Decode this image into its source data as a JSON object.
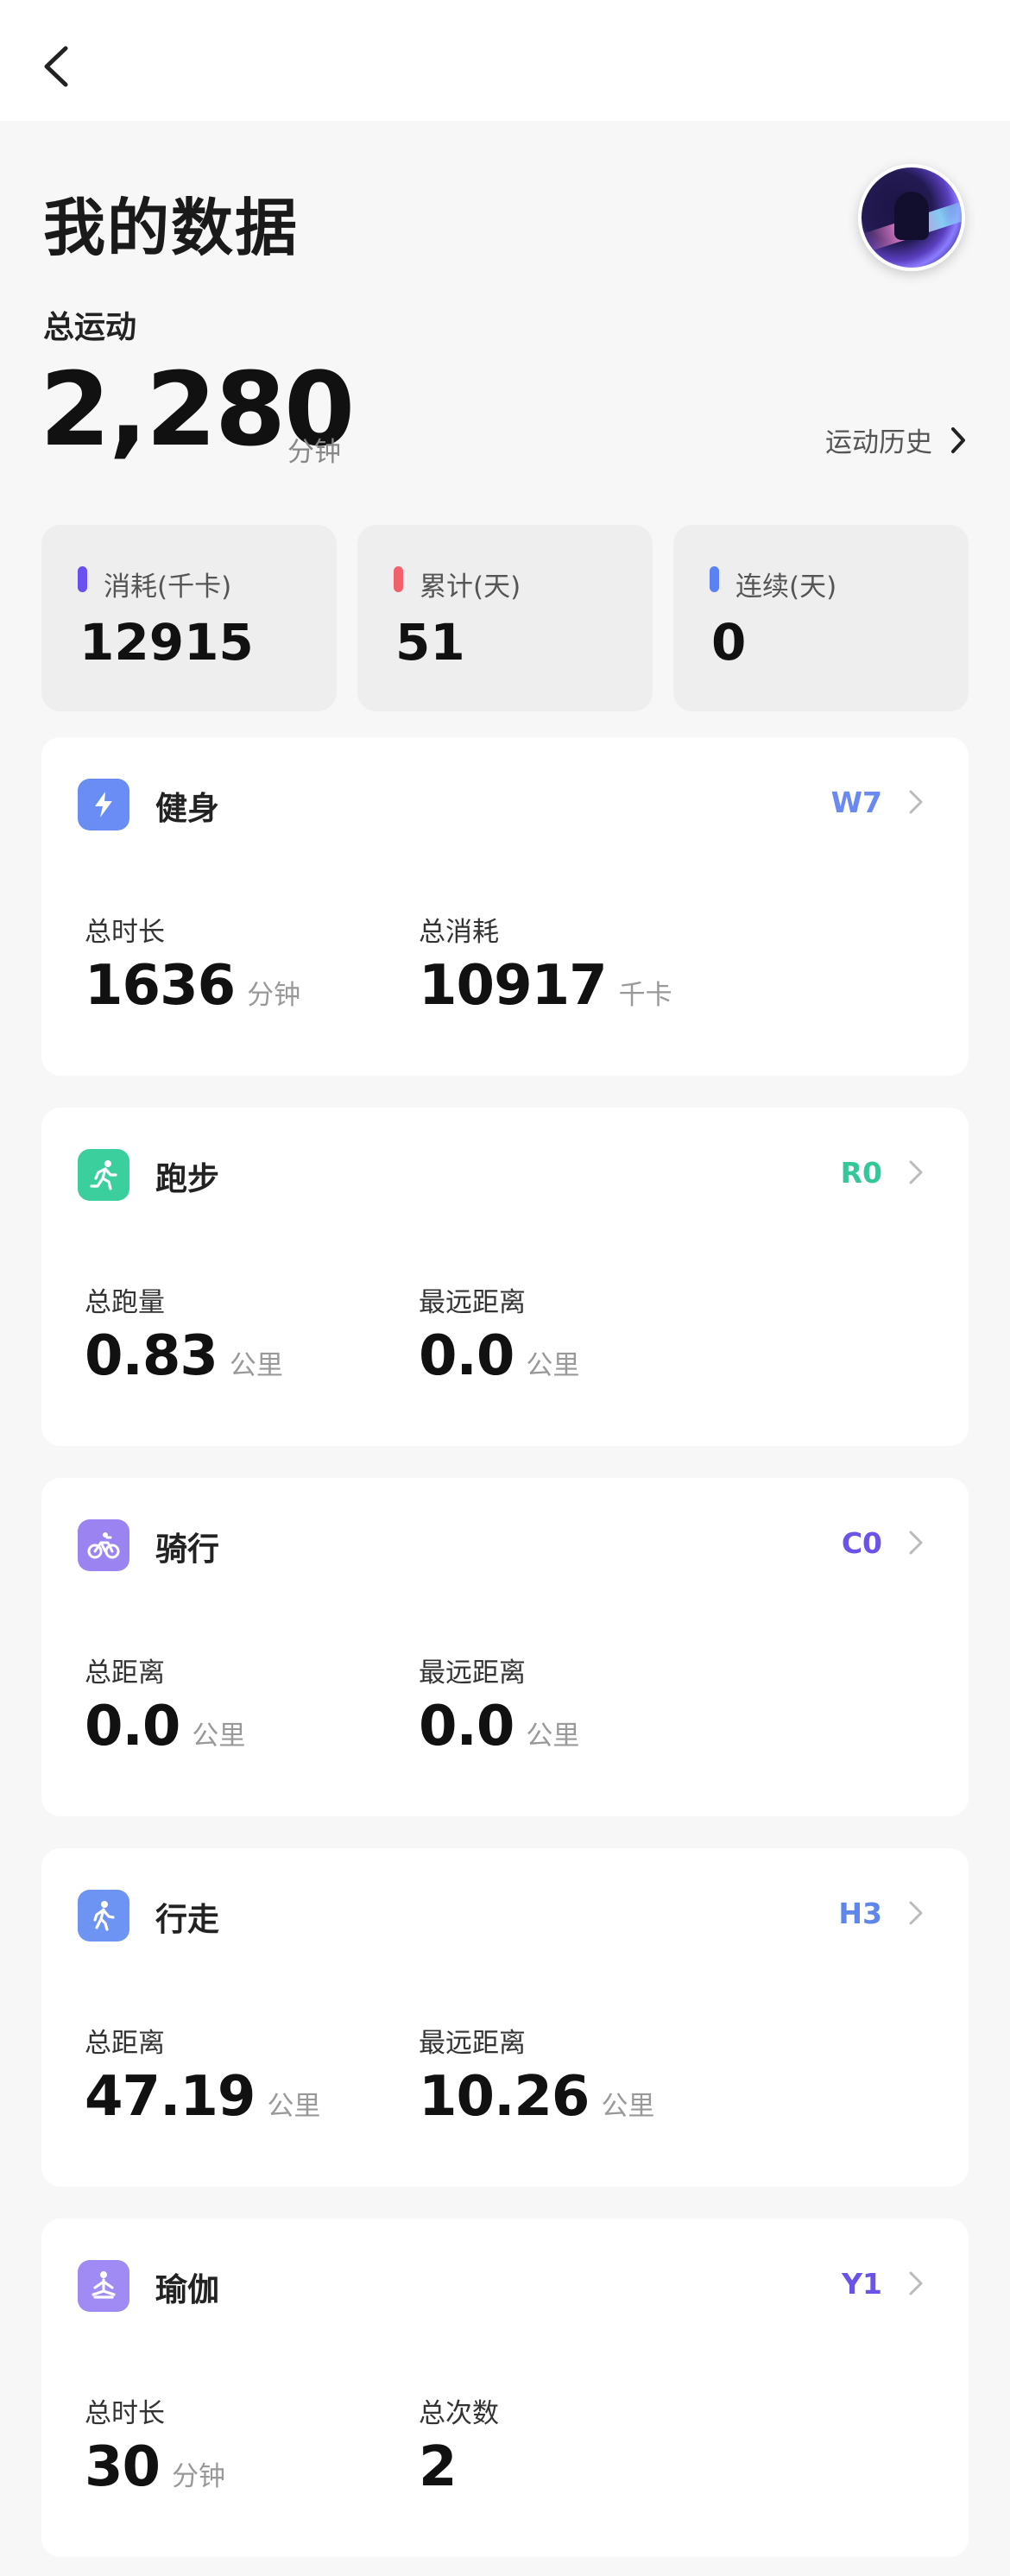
{
  "header": {
    "title": "我的数据",
    "total_label": "总运动",
    "total_value": "2,280",
    "total_unit": "分钟",
    "history_label": "运动历史"
  },
  "stats": [
    {
      "label": "消耗(千卡)",
      "value": "12915",
      "color": "#6b4ff0"
    },
    {
      "label": "累计(天)",
      "value": "51",
      "color": "#f2606c"
    },
    {
      "label": "连续(天)",
      "value": "0",
      "color": "#5b82f5"
    }
  ],
  "sports": [
    {
      "name": "健身",
      "code": "W7",
      "code_color": "#6b8af0",
      "icon": "lightning-icon",
      "icon_color": "#6a8cf5",
      "m1": {
        "label": "总时长",
        "value": "1636",
        "unit": "分钟"
      },
      "m2": {
        "label": "总消耗",
        "value": "10917",
        "unit": "千卡"
      }
    },
    {
      "name": "跑步",
      "code": "R0",
      "code_color": "#34c79a",
      "icon": "running-icon",
      "icon_color": "#3ccf9e",
      "m1": {
        "label": "总跑量",
        "value": "0.83",
        "unit": "公里"
      },
      "m2": {
        "label": "最远距离",
        "value": "0.0",
        "unit": "公里"
      }
    },
    {
      "name": "骑行",
      "code": "C0",
      "code_color": "#6b52e8",
      "icon": "cycling-icon",
      "icon_color": "#9b84f2",
      "m1": {
        "label": "总距离",
        "value": "0.0",
        "unit": "公里"
      },
      "m2": {
        "label": "最远距离",
        "value": "0.0",
        "unit": "公里"
      }
    },
    {
      "name": "行走",
      "code": "H3",
      "code_color": "#5f86ea",
      "icon": "walking-icon",
      "icon_color": "#6d94f2",
      "m1": {
        "label": "总距离",
        "value": "47.19",
        "unit": "公里"
      },
      "m2": {
        "label": "最远距离",
        "value": "10.26",
        "unit": "公里"
      }
    },
    {
      "name": "瑜伽",
      "code": "Y1",
      "code_color": "#6b52e8",
      "icon": "yoga-icon",
      "icon_color": "#a08af4",
      "m1": {
        "label": "总时长",
        "value": "30",
        "unit": "分钟"
      },
      "m2": {
        "label": "总次数",
        "value": "2",
        "unit": ""
      }
    }
  ]
}
